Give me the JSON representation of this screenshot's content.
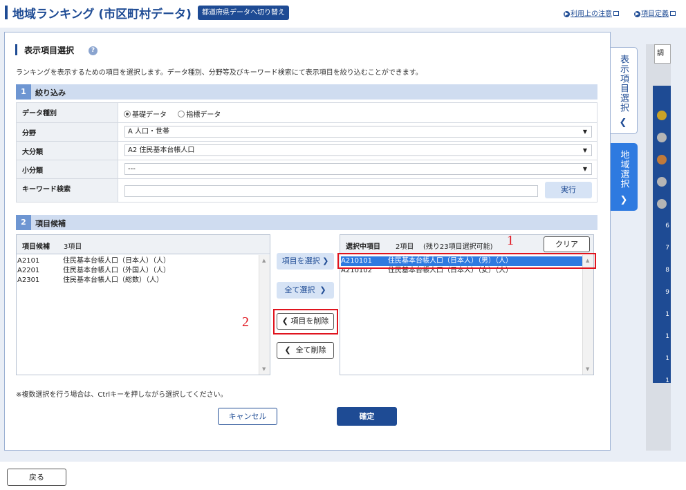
{
  "header": {
    "title": "地域ランキング (市区町村データ)",
    "switch_button": "都道府県データへ切り替え",
    "link_notes": "利用上の注意",
    "link_defs": "項目定義"
  },
  "section": {
    "title": "表示項目選択",
    "description": "ランキングを表示するための項目を選択します。データ種別、分野等及びキーワード検索にて表示項目を絞り込むことができます。"
  },
  "step1": {
    "num": "1",
    "label": "絞り込み",
    "rows": {
      "data_type_label": "データ種別",
      "radio_basic": "基礎データ",
      "radio_index": "指標データ",
      "field_label": "分野",
      "field_value": "A 人口・世帯",
      "major_label": "大分類",
      "major_value": "A2 住民基本台帳人口",
      "minor_label": "小分類",
      "minor_value": "---",
      "keyword_label": "キーワード検索",
      "keyword_value": "",
      "run_button": "実行"
    }
  },
  "step2": {
    "num": "2",
    "label": "項目候補",
    "candidates": {
      "title": "項目候補",
      "count": "3項目",
      "items": [
        {
          "code": "A2101",
          "name": "住民基本台帳人口（日本人）（人）"
        },
        {
          "code": "A2201",
          "name": "住民基本台帳人口（外国人）（人）"
        },
        {
          "code": "A2301",
          "name": "住民基本台帳人口（総数）（人）"
        }
      ]
    },
    "selected": {
      "title": "選択中項目",
      "count": "2項目",
      "remaining": "(残り23項目選択可能)",
      "clear_button": "クリア",
      "items": [
        {
          "code": "A210101",
          "name": "住民基本台帳人口（日本人）（男）（人）"
        },
        {
          "code": "A210102",
          "name": "住民基本台帳人口（日本人）（女）（人）"
        }
      ]
    },
    "buttons": {
      "select": "項目を選択",
      "select_all": "全て選択",
      "remove": "項目を削除",
      "remove_all": "全て削除"
    },
    "annotations": {
      "first": "1",
      "second": "2"
    }
  },
  "footer": {
    "note": "※複数選択を行う場合は、Ctrlキーを押しながら選択してください。",
    "cancel": "キャンセル",
    "confirm": "確定",
    "back": "戻る"
  },
  "side_tabs": {
    "display_items": "表示項目選択",
    "region_select": "地域選択"
  },
  "right_panel": {
    "header_text": "調査",
    "numbers": [
      "6",
      "7",
      "8",
      "9",
      "1",
      "1",
      "1",
      "1"
    ]
  },
  "colors": {
    "brand": "#1e4b94",
    "accent_light": "#d6e3f5",
    "selection": "#2e7ae0",
    "annotation": "#e0141e"
  }
}
